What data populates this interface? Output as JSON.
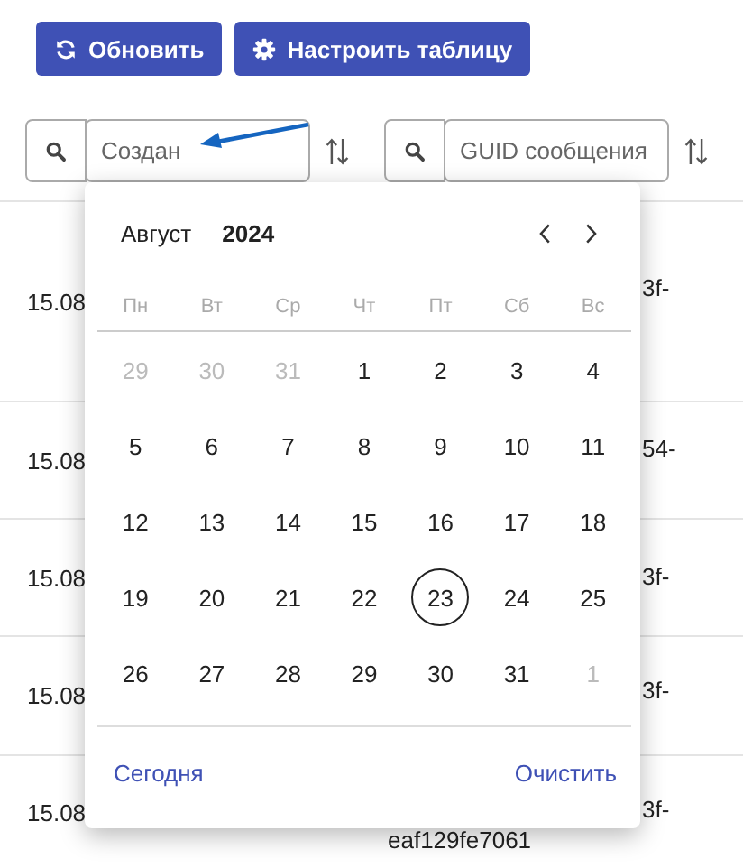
{
  "toolbar": {
    "buttons": [
      {
        "label": "Обновить",
        "kind": "refresh"
      },
      {
        "label": "Настроить таблицу",
        "kind": "settings"
      }
    ]
  },
  "filters": [
    {
      "placeholder": "Создан"
    },
    {
      "placeholder": "GUID сообщения"
    }
  ],
  "table": {
    "rows": [
      {
        "date": "15.08",
        "guid_lines": [
          "3f-"
        ]
      },
      {
        "date": "15.08",
        "guid_lines": [
          "54-"
        ]
      },
      {
        "date": "15.08",
        "guid_lines": [
          "3f-"
        ]
      },
      {
        "date": "15.08",
        "guid_lines": [
          "3f-"
        ]
      },
      {
        "date": "15.08",
        "guid_lines": [
          "3f-",
          "eaf129fe7061"
        ]
      }
    ]
  },
  "datepicker": {
    "month": "Август",
    "year": "2024",
    "weekdays": [
      "Пн",
      "Вт",
      "Ср",
      "Чт",
      "Пт",
      "Сб",
      "Вс"
    ],
    "weeks": [
      [
        {
          "label": "29",
          "outside": true,
          "today": false
        },
        {
          "label": "30",
          "outside": true,
          "today": false
        },
        {
          "label": "31",
          "outside": true,
          "today": false
        },
        {
          "label": "1",
          "outside": false,
          "today": false
        },
        {
          "label": "2",
          "outside": false,
          "today": false
        },
        {
          "label": "3",
          "outside": false,
          "today": false
        },
        {
          "label": "4",
          "outside": false,
          "today": false
        }
      ],
      [
        {
          "label": "5",
          "outside": false,
          "today": false
        },
        {
          "label": "6",
          "outside": false,
          "today": false
        },
        {
          "label": "7",
          "outside": false,
          "today": false
        },
        {
          "label": "8",
          "outside": false,
          "today": false
        },
        {
          "label": "9",
          "outside": false,
          "today": false
        },
        {
          "label": "10",
          "outside": false,
          "today": false
        },
        {
          "label": "11",
          "outside": false,
          "today": false
        }
      ],
      [
        {
          "label": "12",
          "outside": false,
          "today": false
        },
        {
          "label": "13",
          "outside": false,
          "today": false
        },
        {
          "label": "14",
          "outside": false,
          "today": false
        },
        {
          "label": "15",
          "outside": false,
          "today": false
        },
        {
          "label": "16",
          "outside": false,
          "today": false
        },
        {
          "label": "17",
          "outside": false,
          "today": false
        },
        {
          "label": "18",
          "outside": false,
          "today": false
        }
      ],
      [
        {
          "label": "19",
          "outside": false,
          "today": false
        },
        {
          "label": "20",
          "outside": false,
          "today": false
        },
        {
          "label": "21",
          "outside": false,
          "today": false
        },
        {
          "label": "22",
          "outside": false,
          "today": false
        },
        {
          "label": "23",
          "outside": false,
          "today": true
        },
        {
          "label": "24",
          "outside": false,
          "today": false
        },
        {
          "label": "25",
          "outside": false,
          "today": false
        }
      ],
      [
        {
          "label": "26",
          "outside": false,
          "today": false
        },
        {
          "label": "27",
          "outside": false,
          "today": false
        },
        {
          "label": "28",
          "outside": false,
          "today": false
        },
        {
          "label": "29",
          "outside": false,
          "today": false
        },
        {
          "label": "30",
          "outside": false,
          "today": false
        },
        {
          "label": "31",
          "outside": false,
          "today": false
        },
        {
          "label": "1",
          "outside": true,
          "today": false
        }
      ]
    ],
    "footer": {
      "today_label": "Сегодня",
      "clear_label": "Очистить"
    }
  }
}
